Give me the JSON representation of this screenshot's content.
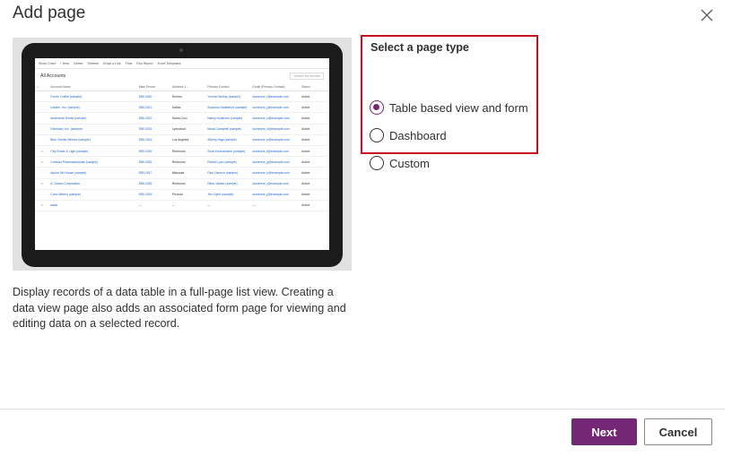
{
  "dialog": {
    "title": "Add page",
    "close_icon": "close-icon"
  },
  "preview": {
    "commands": [
      "Show Chart",
      "+ New",
      "Delete",
      "Refresh",
      "Email a Link",
      "Flow",
      "Run Report",
      "Excel Templates"
    ],
    "view_title": "All Accounts",
    "search_placeholder": "Search for records",
    "columns": [
      "Account Name",
      "Main Phone",
      "Address 1 ...",
      "Primary Contact",
      "Email (Primary Contact)",
      "Status"
    ],
    "rows": [
      {
        "name": "Fourth Coffee (sample)",
        "phone": "555-0150",
        "city": "Renton",
        "contact": "Yvonne McKay (sample)",
        "email": "someone_i@example.com",
        "status": "Active"
      },
      {
        "name": "Litware, Inc. (sample)",
        "phone": "555-0151",
        "city": "Dallas",
        "contact": "Susanna Stubberod (sample)",
        "email": "someone_j@example.com",
        "status": "Active"
      },
      {
        "name": "Adventure Works (sample)",
        "phone": "555-0152",
        "city": "Santa Cruz",
        "contact": "Nancy Anderson (sample)",
        "email": "someone_c@example.com",
        "status": "Active"
      },
      {
        "name": "Fabrikam, Inc. (sample)",
        "phone": "555-0153",
        "city": "Lynnwood",
        "contact": "Maria Campbell (sample)",
        "email": "someone_d@example.com",
        "status": "Active"
      },
      {
        "name": "Blue Yonder Airlines (sample)",
        "phone": "555-0154",
        "city": "Los Angeles",
        "contact": "Sidney Higa (sample)",
        "email": "someone_e@example.com",
        "status": "Active"
      },
      {
        "name": "City Power & Light (sample)",
        "phone": "555-0155",
        "city": "Redmond",
        "contact": "Scott Konersmann (sample)",
        "email": "someone_f@example.com",
        "status": "Active"
      },
      {
        "name": "Contoso Pharmaceuticals (sample)",
        "phone": "555-0156",
        "city": "Redmond",
        "contact": "Robert Lyon (sample)",
        "email": "someone_g@example.com",
        "status": "Active"
      },
      {
        "name": "Alpine Ski House (sample)",
        "phone": "555-0157",
        "city": "Missoula",
        "contact": "Paul Cannon (sample)",
        "email": "someone_h@example.com",
        "status": "Active"
      },
      {
        "name": "A. Datum Corporation",
        "phone": "555-0158",
        "city": "Redmond",
        "contact": "Rene Valdes (sample)",
        "email": "someone_i@example.com",
        "status": "Active"
      },
      {
        "name": "Coho Winery (sample)",
        "phone": "555-0159",
        "city": "Phoenix",
        "contact": "Jim Glynn (sample)",
        "email": "someone_j@example.com",
        "status": "Active"
      },
      {
        "name": "aaaa",
        "phone": "---",
        "city": "---",
        "contact": "---",
        "email": "---",
        "status": "Active"
      }
    ]
  },
  "description": "Display records of a data table in a full-page list view. Creating a data view page also adds an associated form page for viewing and editing data on a selected record.",
  "page_type": {
    "label": "Select a page type",
    "selected": "Table based view and form",
    "options": [
      "Table based view and form",
      "Dashboard",
      "Custom"
    ]
  },
  "footer": {
    "next_label": "Next",
    "cancel_label": "Cancel"
  },
  "colors": {
    "accent": "#742774",
    "highlight_border": "#c50f1f"
  }
}
